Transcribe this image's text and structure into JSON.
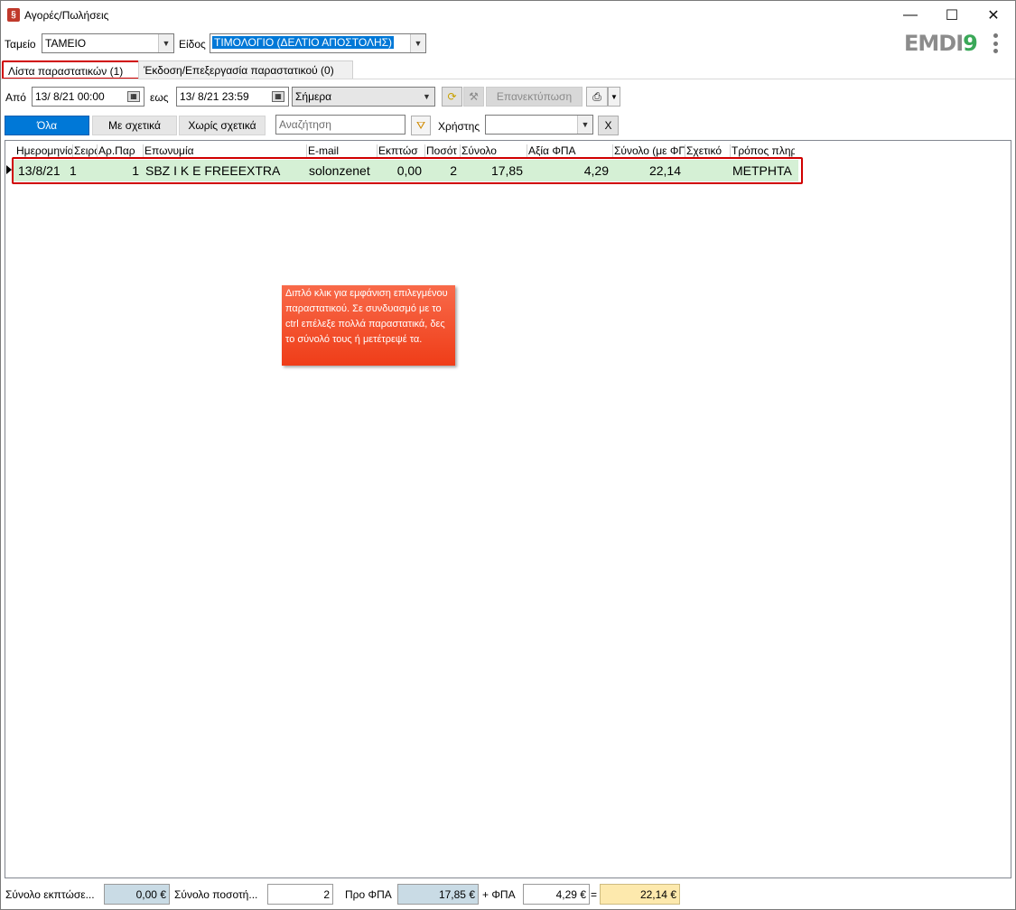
{
  "window": {
    "title": "Αγορές/Πωλήσεις",
    "minimize": "—",
    "maximize": "☐",
    "close": "✕"
  },
  "header": {
    "cash_label": "Ταμείο",
    "cash_value": "ΤΑΜΕΙΟ",
    "kind_label": "Είδος",
    "kind_value": "ΤΙΜΟΛΟΓΙΟ (ΔΕΛΤΙΟ ΑΠΟΣΤΟΛΗΣ)",
    "logo_main": "EMDI",
    "logo_accent": "9"
  },
  "tabs": [
    {
      "label": "Λίστα παραστατικών (1)",
      "active": true
    },
    {
      "label": "Έκδοση/Επεξεργασία παραστατικού (0)",
      "active": false
    }
  ],
  "dates": {
    "from_label": "Από",
    "from_value": "13/  8/21 00:00",
    "to_label": "εως",
    "to_value": "13/  8/21 23:59",
    "period_value": "Σήμερα",
    "reprint_label": "Επανεκτύπωση"
  },
  "filters": {
    "all_label": "Όλα",
    "related_label": "Με σχετικά",
    "unrelated_label": "Χωρίς σχετικά",
    "search_placeholder": "Αναζήτηση",
    "user_label": "Χρήστης",
    "user_value": "",
    "clear_label": "X"
  },
  "table": {
    "columns": [
      "Ημερομηνία",
      "Σειρά",
      "Αρ.Παρ",
      "Επωνυμία",
      "E-mail",
      "Εκπτώσ",
      "Ποσότ",
      "Σύνολο",
      "Αξία ΦΠΑ",
      "Σύνολο (με ΦΠΑ)",
      "Σχετικό",
      "Τρόπος πληρ."
    ],
    "rows": [
      {
        "date": "13/8/21",
        "series": "1",
        "number": "1",
        "name": "SBZ I K E  FREEEXTRA",
        "email": "solonzenet",
        "discount": "0,00",
        "quantity": "2",
        "total": "17,85",
        "vat": "4,29",
        "total_vat": "22,14",
        "related": "",
        "payment": "ΜΕΤΡΗΤΑ"
      }
    ]
  },
  "tooltip": {
    "text": "Διπλό κλικ για εμφάνιση επιλεγμένου παραστατικού. Σε συνδυασμό με το ctrl επέλεξε πολλά παραστατικά, δες το σύνολό τους ή μετέτρεψέ τα."
  },
  "footer": {
    "discount_label": "Σύνολο εκπτώσε...",
    "discount_value": "0,00 €",
    "qty_label": "Σύνολο ποσοτή...",
    "qty_value": "2",
    "pre_vat_label": "Προ ΦΠΑ",
    "pre_vat_value": "17,85 €",
    "plus_vat_label": "+ ΦΠΑ",
    "vat_value": "4,29 €",
    "equals": "=",
    "grand_total": "22,14 €"
  }
}
